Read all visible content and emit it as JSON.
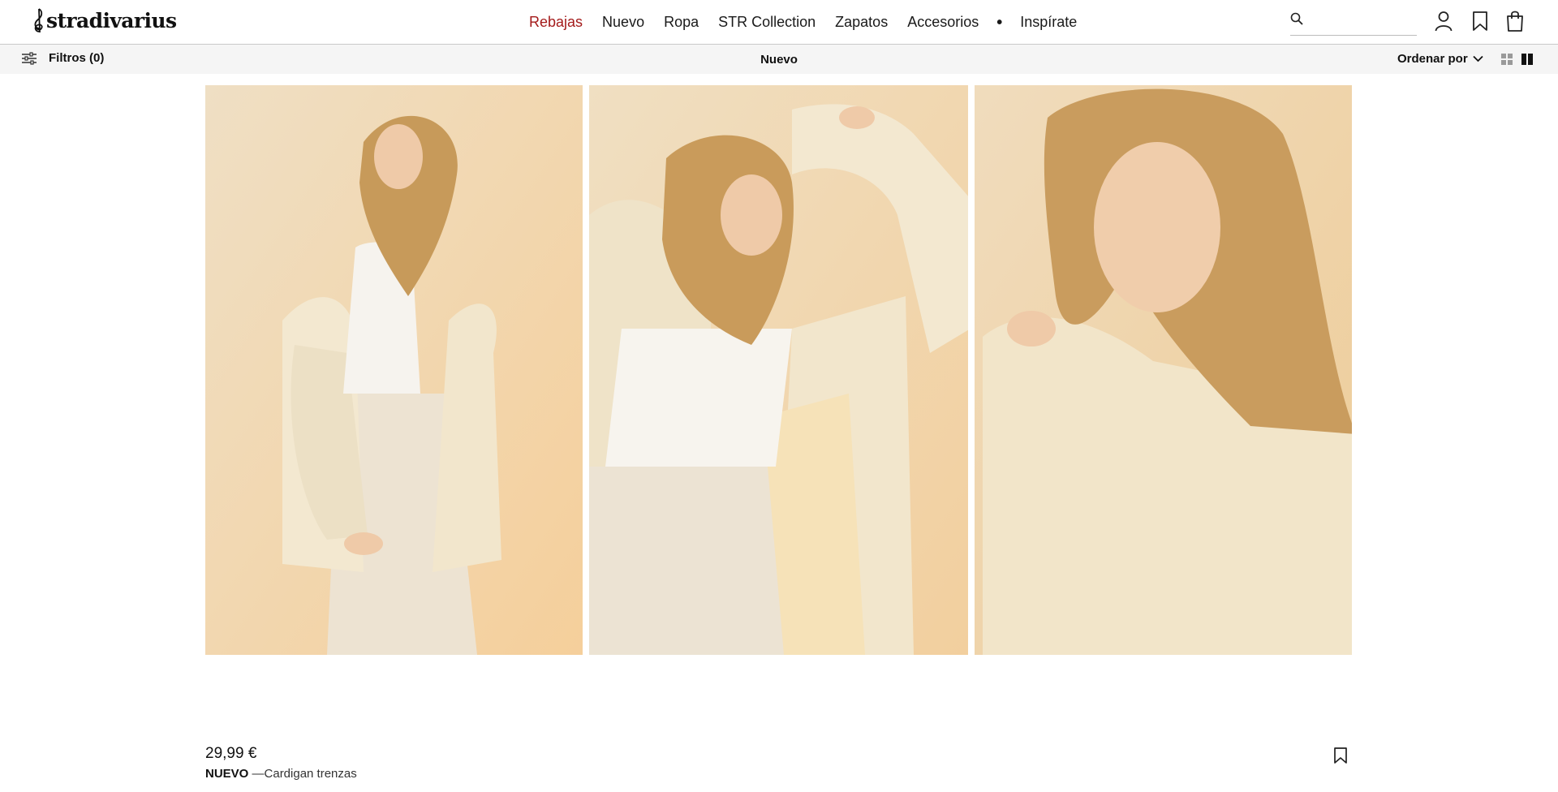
{
  "brand": {
    "name": "stradivarius"
  },
  "nav": {
    "items": [
      "Rebajas",
      "Nuevo",
      "Ropa",
      "STR Collection",
      "Zapatos",
      "Accesorios",
      "•",
      "Inspírate"
    ],
    "sale_color": "#a41b1b"
  },
  "search": {
    "placeholder": "",
    "icon": "search-icon"
  },
  "header_icons": [
    "user-icon",
    "bookmark-icon",
    "shopping-bag-icon"
  ],
  "subbar": {
    "filters_label": "Filtros (0)",
    "title": "Nuevo",
    "sort_label": "Ordenar por",
    "view_icons": [
      "grid-small-icon",
      "grid-large-icon"
    ]
  },
  "product": {
    "price": "29,99 €",
    "tag": "NUEVO",
    "separator": " —",
    "name": "Cardigan trenzas",
    "images": [
      "model-photo-1",
      "model-photo-2",
      "model-photo-3"
    ]
  }
}
